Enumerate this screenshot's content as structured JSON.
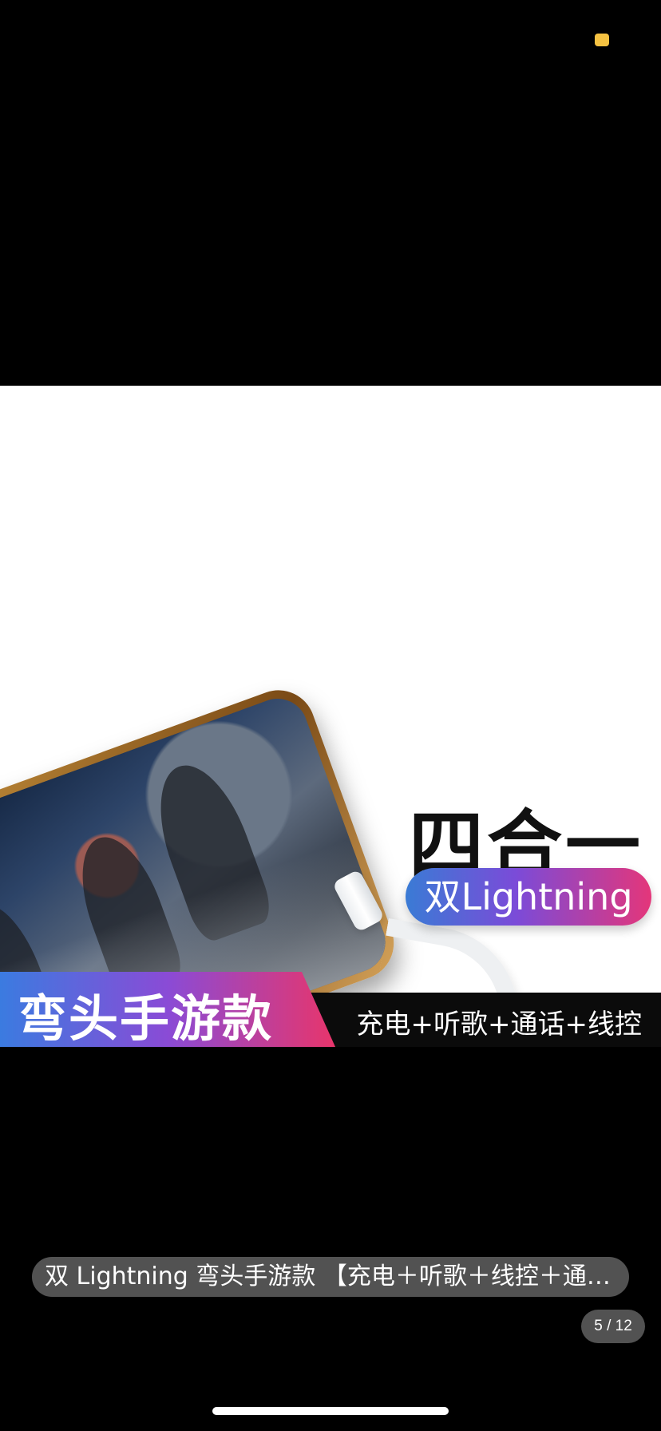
{
  "product_image": {
    "headline": "四合一",
    "badge": "双Lightning",
    "banner_left": "弯头手游款",
    "banner_right": "充电+听歌+通话+线控"
  },
  "caption": "双 Lightning 弯头手游款 【充电＋听歌＋线控＋通…",
  "pager": "5 / 12",
  "icons": {
    "headphone_port": "headphone-icon",
    "charge_port": "lightning-bolt-icon"
  },
  "colors": {
    "badge_gradient": [
      "#3a7bd5",
      "#7b4bd8",
      "#e4367a"
    ],
    "status_dot": "#f5c242"
  }
}
